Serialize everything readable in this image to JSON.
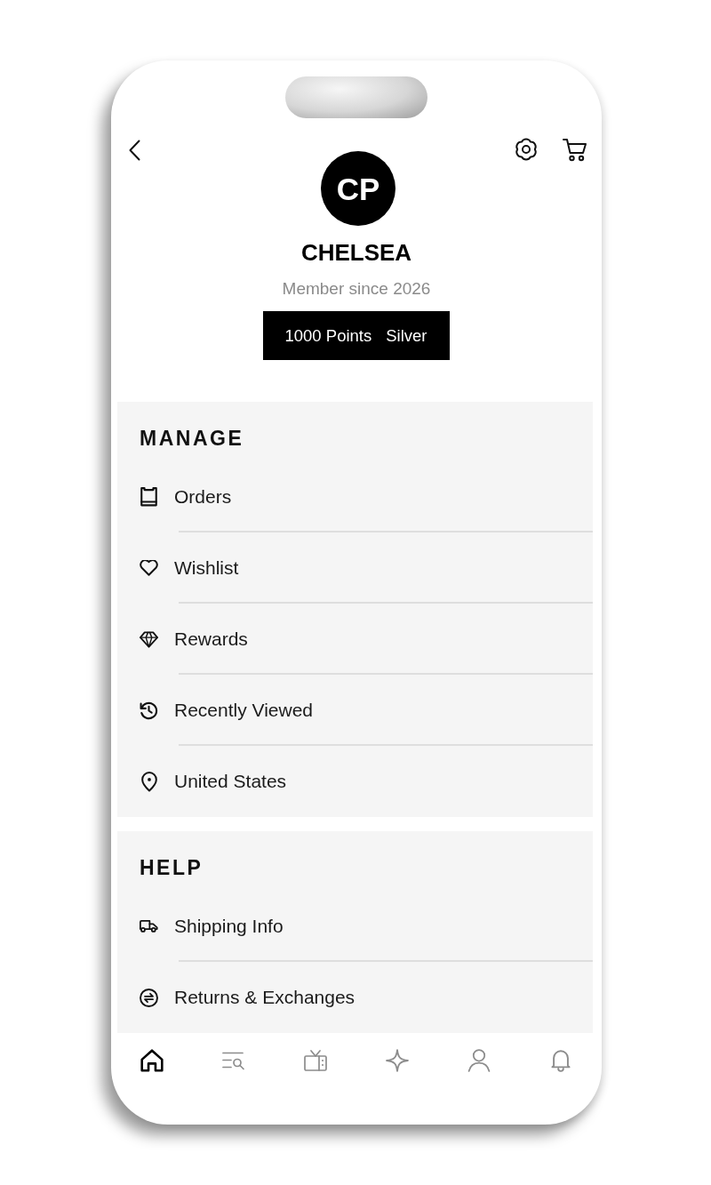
{
  "profile": {
    "initials": "CP",
    "name": "CHELSEA",
    "member_since": "Member since 2026",
    "points": "1000 Points",
    "tier": "Silver"
  },
  "sections": [
    {
      "title": "MANAGE",
      "items": [
        "Orders",
        "Wishlist",
        "Rewards",
        "Recently Viewed",
        "United States"
      ]
    },
    {
      "title": "HELP",
      "items": [
        "Shipping Info",
        "Returns & Exchanges"
      ]
    }
  ],
  "bottom_nav": [
    {
      "selected": true
    },
    {
      "selected": false
    },
    {
      "selected": false
    },
    {
      "selected": false
    },
    {
      "selected": false
    },
    {
      "selected": false
    }
  ]
}
